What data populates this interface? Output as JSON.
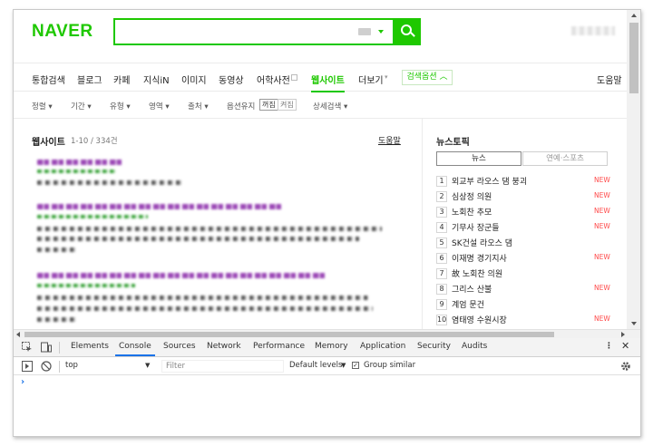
{
  "header": {
    "logo": "NAVER",
    "search": {
      "value": "",
      "placeholder": ""
    }
  },
  "tabs": [
    {
      "label": "통합검색"
    },
    {
      "label": "블로그"
    },
    {
      "label": "카페"
    },
    {
      "label": "지식iN"
    },
    {
      "label": "이미지"
    },
    {
      "label": "동영상"
    },
    {
      "label": "어학사전"
    },
    {
      "label": "웹사이트"
    },
    {
      "label": "더보기"
    }
  ],
  "active_tab": "웹사이트",
  "search_options_label": "검색옵션",
  "help_label": "도움말",
  "filters": [
    {
      "label": "정렬"
    },
    {
      "label": "기간"
    },
    {
      "label": "유형"
    },
    {
      "label": "영역"
    },
    {
      "label": "출처"
    },
    {
      "label": "옵션유지"
    },
    {
      "label": "꺼짐"
    },
    {
      "label": "켜짐"
    },
    {
      "label": "상세검색"
    }
  ],
  "results": {
    "title": "웹사이트",
    "count": "1-10 / 334건",
    "help": "도움말"
  },
  "news": {
    "title": "뉴스토픽",
    "tabs": [
      "뉴스",
      "연예·스포츠"
    ],
    "items": [
      {
        "rank": "1",
        "text": "외교부 라오스 댐 붕괴",
        "badge": "NEW"
      },
      {
        "rank": "2",
        "text": "심상정 의원",
        "badge": "NEW"
      },
      {
        "rank": "3",
        "text": "노회찬 추모",
        "badge": "NEW"
      },
      {
        "rank": "4",
        "text": "기무사 장군들",
        "badge": "NEW"
      },
      {
        "rank": "5",
        "text": "SK건설 라오스 댐",
        "badge": ""
      },
      {
        "rank": "6",
        "text": "이재명 경기지사",
        "badge": "NEW"
      },
      {
        "rank": "7",
        "text": "故 노회찬 의원",
        "badge": ""
      },
      {
        "rank": "8",
        "text": "그리스 산불",
        "badge": "NEW"
      },
      {
        "rank": "9",
        "text": "계엄 문건",
        "badge": ""
      },
      {
        "rank": "10",
        "text": "염태영 수원시장",
        "badge": "NEW"
      }
    ]
  },
  "devtools": {
    "tabs": [
      "Elements",
      "Console",
      "Sources",
      "Network",
      "Performance",
      "Memory",
      "Application",
      "Security",
      "Audits"
    ],
    "active": "Console",
    "context": "top",
    "filter_placeholder": "Filter",
    "levels": "Default levels",
    "group_similar": "Group similar",
    "prompt": "›"
  }
}
